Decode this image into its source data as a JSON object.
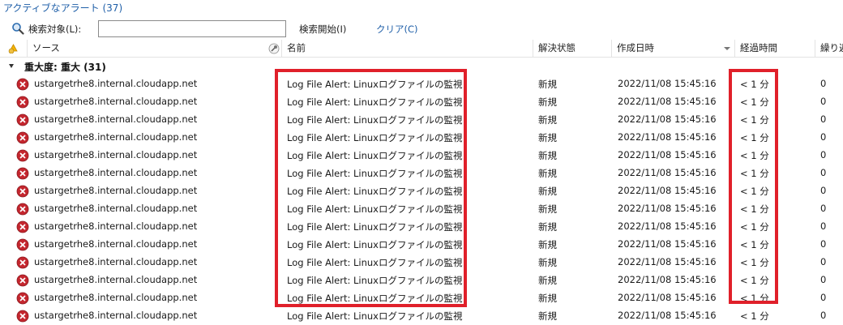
{
  "title": "アクティブなアラート (37)",
  "search": {
    "label": "検索対象(L):",
    "value": "",
    "start_label": "検索開始(I)",
    "clear_label": "クリア(C)"
  },
  "columns": {
    "source": "ソース",
    "name": "名前",
    "resolution": "解決状態",
    "created": "作成日時",
    "age": "経過時間",
    "repeat": "繰り返"
  },
  "group": {
    "label": "重大度: 重大 (31)"
  },
  "alerts": [
    {
      "source": "ustargetrhe8.internal.cloudapp.net",
      "name": "Log File Alert:  Linuxログファイルの監視",
      "resolution": "新規",
      "created": "2022/11/08 15:45:16",
      "age": "< 1 分",
      "repeat": "0"
    },
    {
      "source": "ustargetrhe8.internal.cloudapp.net",
      "name": "Log File Alert:  Linuxログファイルの監視",
      "resolution": "新規",
      "created": "2022/11/08 15:45:16",
      "age": "< 1 分",
      "repeat": "0"
    },
    {
      "source": "ustargetrhe8.internal.cloudapp.net",
      "name": "Log File Alert:  Linuxログファイルの監視",
      "resolution": "新規",
      "created": "2022/11/08 15:45:16",
      "age": "< 1 分",
      "repeat": "0"
    },
    {
      "source": "ustargetrhe8.internal.cloudapp.net",
      "name": "Log File Alert:  Linuxログファイルの監視",
      "resolution": "新規",
      "created": "2022/11/08 15:45:16",
      "age": "< 1 分",
      "repeat": "0"
    },
    {
      "source": "ustargetrhe8.internal.cloudapp.net",
      "name": "Log File Alert:  Linuxログファイルの監視",
      "resolution": "新規",
      "created": "2022/11/08 15:45:16",
      "age": "< 1 分",
      "repeat": "0"
    },
    {
      "source": "ustargetrhe8.internal.cloudapp.net",
      "name": "Log File Alert:  Linuxログファイルの監視",
      "resolution": "新規",
      "created": "2022/11/08 15:45:16",
      "age": "< 1 分",
      "repeat": "0"
    },
    {
      "source": "ustargetrhe8.internal.cloudapp.net",
      "name": "Log File Alert:  Linuxログファイルの監視",
      "resolution": "新規",
      "created": "2022/11/08 15:45:16",
      "age": "< 1 分",
      "repeat": "0"
    },
    {
      "source": "ustargetrhe8.internal.cloudapp.net",
      "name": "Log File Alert:  Linuxログファイルの監視",
      "resolution": "新規",
      "created": "2022/11/08 15:45:16",
      "age": "< 1 分",
      "repeat": "0"
    },
    {
      "source": "ustargetrhe8.internal.cloudapp.net",
      "name": "Log File Alert:  Linuxログファイルの監視",
      "resolution": "新規",
      "created": "2022/11/08 15:45:16",
      "age": "< 1 分",
      "repeat": "0"
    },
    {
      "source": "ustargetrhe8.internal.cloudapp.net",
      "name": "Log File Alert:  Linuxログファイルの監視",
      "resolution": "新規",
      "created": "2022/11/08 15:45:16",
      "age": "< 1 分",
      "repeat": "0"
    },
    {
      "source": "ustargetrhe8.internal.cloudapp.net",
      "name": "Log File Alert:  Linuxログファイルの監視",
      "resolution": "新規",
      "created": "2022/11/08 15:45:16",
      "age": "< 1 分",
      "repeat": "0"
    },
    {
      "source": "ustargetrhe8.internal.cloudapp.net",
      "name": "Log File Alert:  Linuxログファイルの監視",
      "resolution": "新規",
      "created": "2022/11/08 15:45:16",
      "age": "< 1 分",
      "repeat": "0"
    },
    {
      "source": "ustargetrhe8.internal.cloudapp.net",
      "name": "Log File Alert:  Linuxログファイルの監視",
      "resolution": "新規",
      "created": "2022/11/08 15:45:16",
      "age": "< 1 分",
      "repeat": "0"
    },
    {
      "source": "ustargetrhe8.internal.cloudapp.net",
      "name": "Log File Alert:  Linuxログファイルの監視",
      "resolution": "新規",
      "created": "2022/11/08 15:45:16",
      "age": "< 1 分",
      "repeat": "0"
    }
  ],
  "icons": {
    "error": "error-circle-icon",
    "search": "magnifier-icon",
    "warning": "alert-warning-icon",
    "pin": "pushpin-icon"
  },
  "colors": {
    "highlight": "#e0202a",
    "error": "#c4262e",
    "title": "#1f5fa8"
  }
}
